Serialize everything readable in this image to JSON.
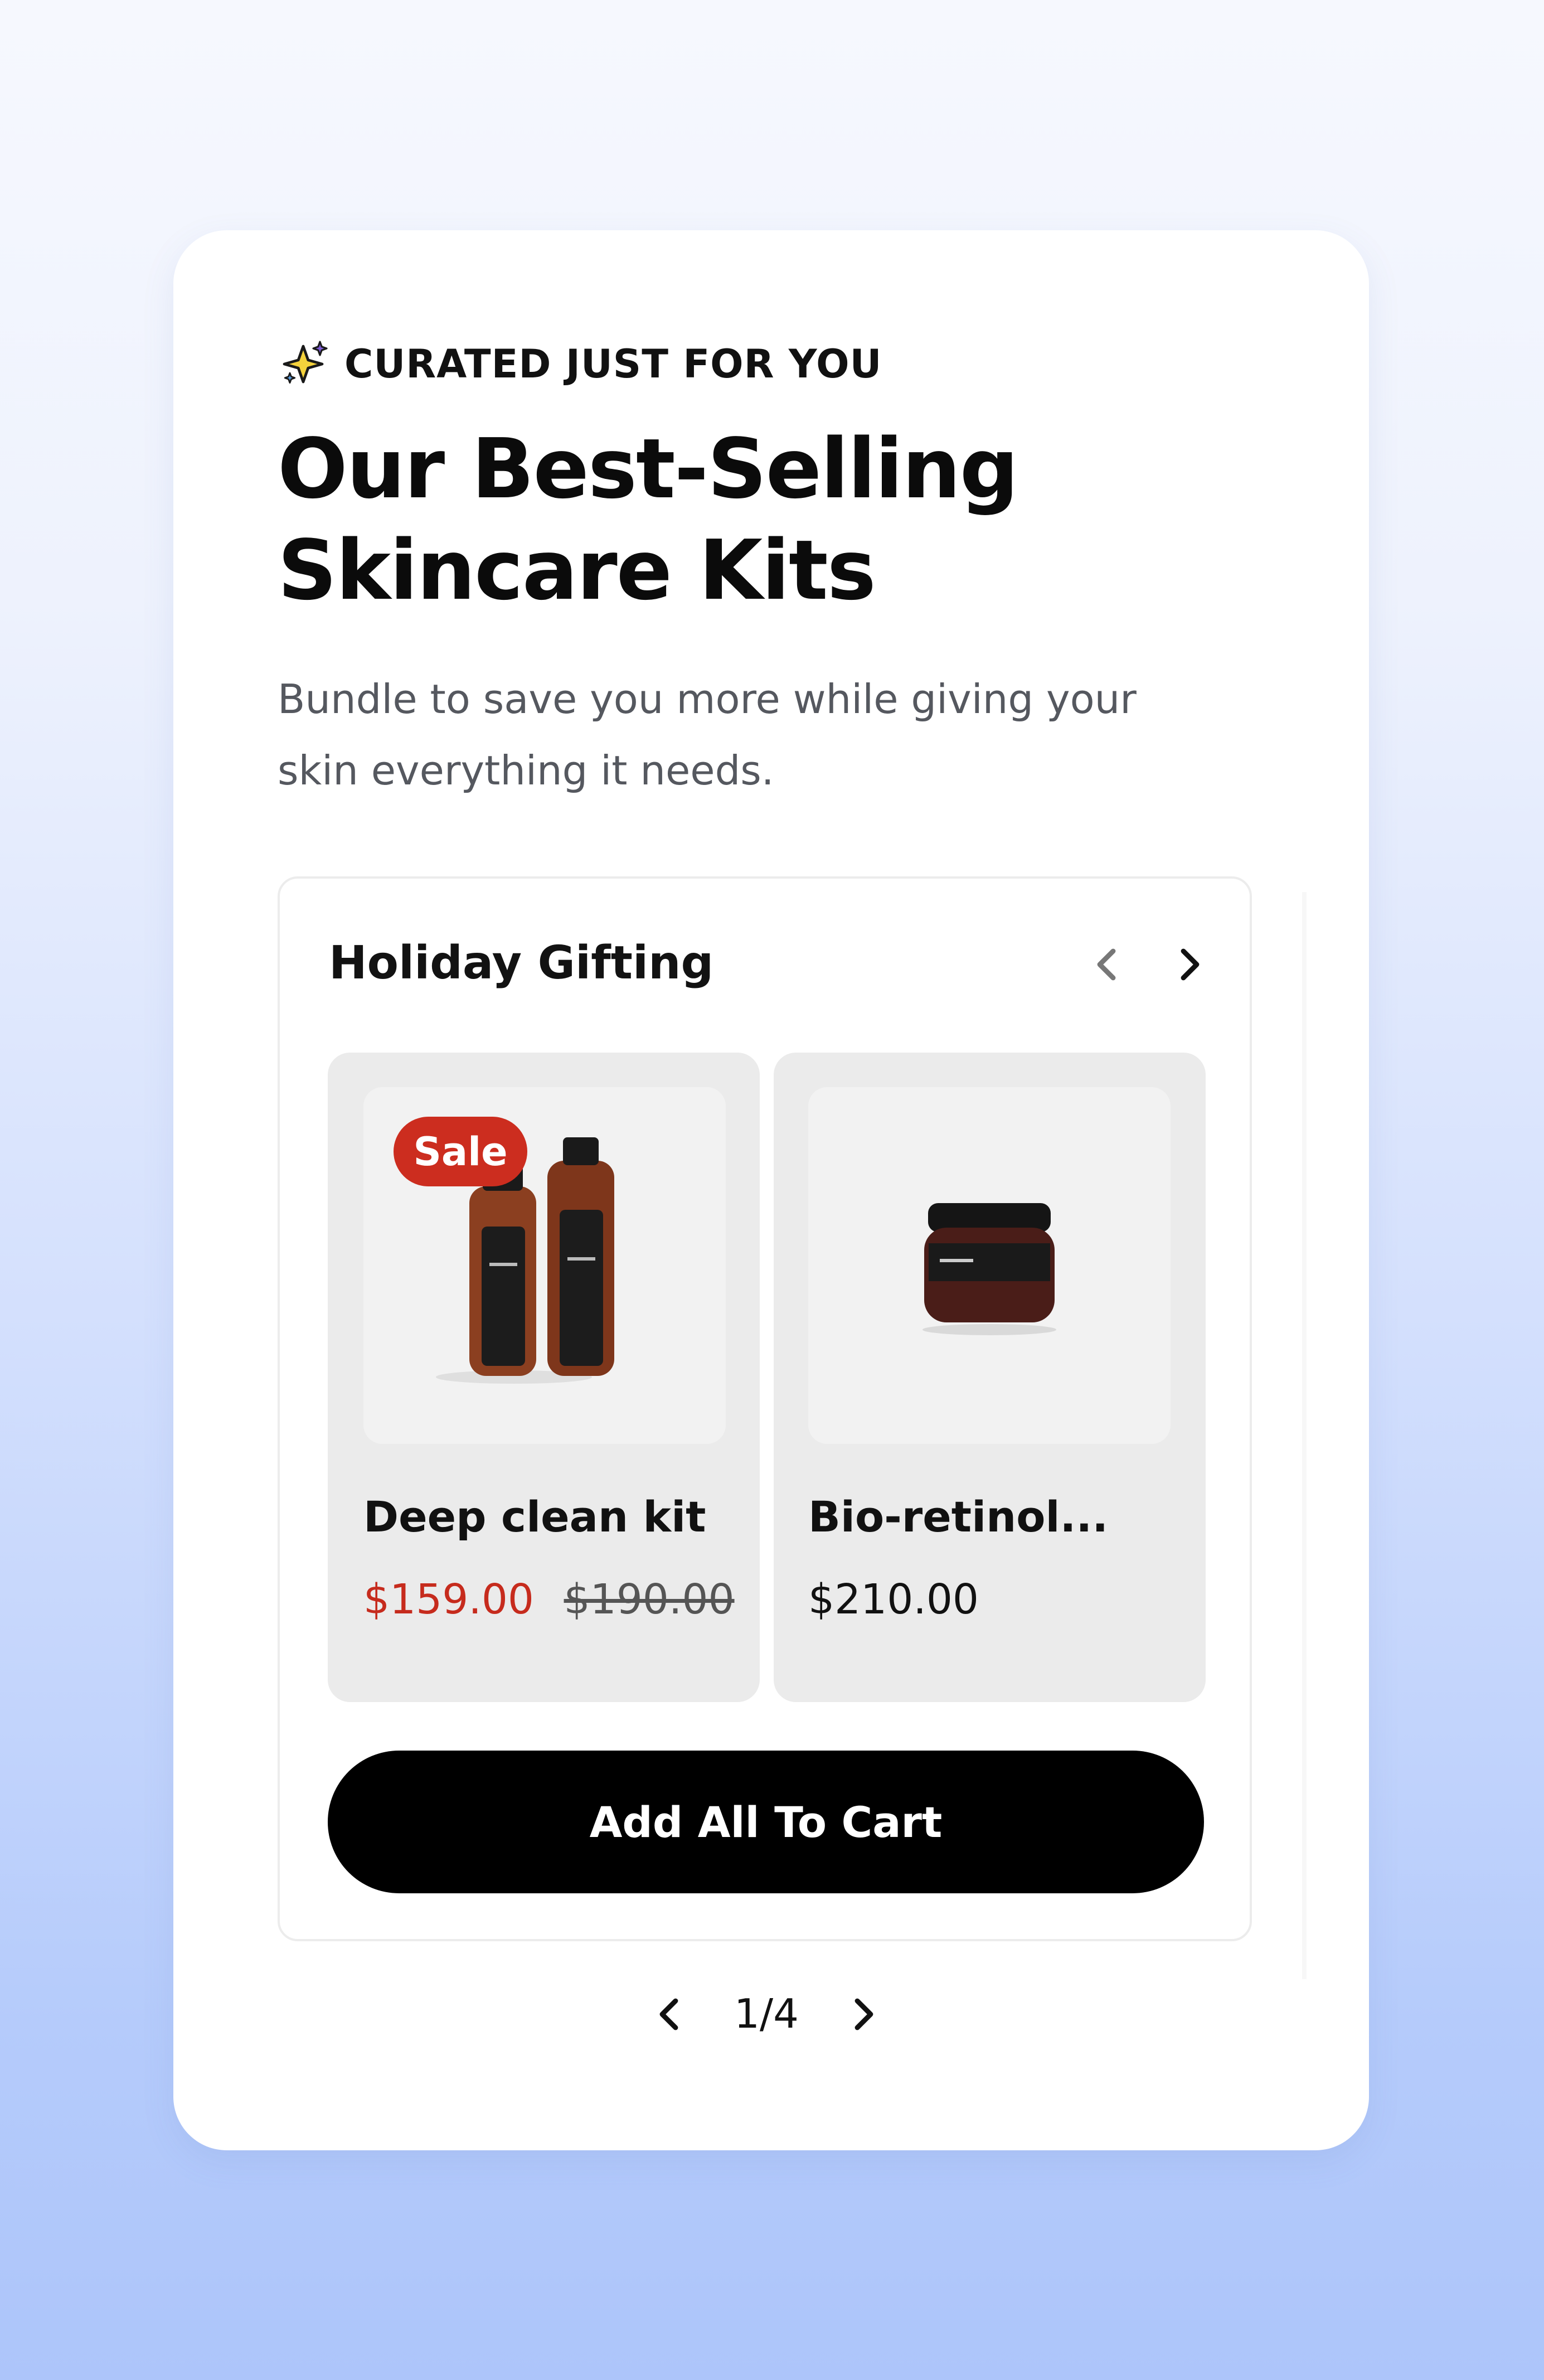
{
  "eyebrow": {
    "icon": "sparkles-icon",
    "text": "CURATED JUST FOR YOU"
  },
  "heading": {
    "title": "Our Best-Selling\nSkincare Kits",
    "description": "Bundle to save you more while giving your skin everything it needs."
  },
  "bundle": {
    "title": "Holiday Gifting",
    "prev_icon": "chevron-left-icon",
    "next_icon": "chevron-right-icon",
    "products": [
      {
        "name": "Deep clean kit",
        "badge": "Sale",
        "price": "$159.00",
        "compare_price": "$190.00"
      },
      {
        "name": "Bio-retinol...",
        "price": "$210.00"
      }
    ],
    "cta_label": "Add All To Cart"
  },
  "pagination": {
    "label": "1/4"
  },
  "colors": {
    "accent": "#c62b1d",
    "button": "#000000",
    "background": "#b5cbfb"
  }
}
